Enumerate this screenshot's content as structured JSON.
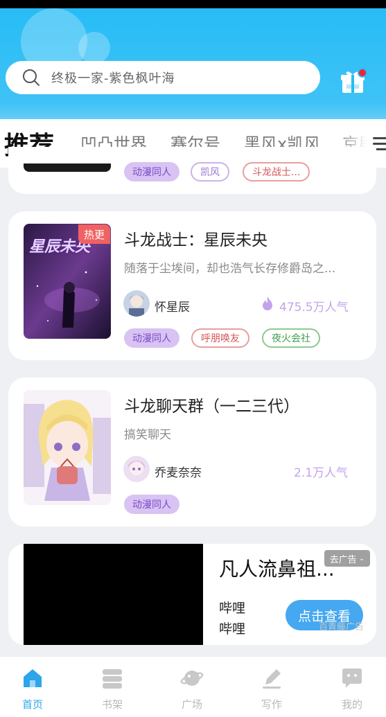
{
  "search": {
    "placeholder": "终极一家-紫色枫叶海"
  },
  "tabs": [
    {
      "label": "推荐",
      "active": true
    },
    {
      "label": "凹凸世界"
    },
    {
      "label": "赛尔号"
    },
    {
      "label": "黑风x凯风"
    },
    {
      "label": "京剧"
    }
  ],
  "cards": [
    {
      "tags": [
        "动漫同人",
        "凯风",
        "斗龙战士..."
      ]
    },
    {
      "title": "斗龙战士：星辰未央",
      "badge": "热更",
      "cover_text": "星辰未央",
      "description": "随落于尘埃间，却也浩气长存修爵岛之...",
      "author": "怀星辰",
      "popularity": "475.5万人气",
      "tags": [
        "动漫同人",
        "呼朋唤友",
        "夜火会社"
      ]
    },
    {
      "title": "斗龙聊天群（一二三代）",
      "description": "搞笑聊天",
      "author": "乔麦奈奈",
      "popularity": "2.1万人气",
      "tags": [
        "动漫同人"
      ]
    }
  ],
  "ad": {
    "title": "凡人流鼻祖...",
    "brand_line1": "哔哩",
    "brand_line2": "哔哩",
    "tag": "去广告",
    "cta": "点击查看",
    "source": "百青藤广告"
  },
  "bottom_nav": [
    {
      "label": "首页",
      "icon": "home-icon",
      "active": true
    },
    {
      "label": "书架",
      "icon": "bookshelf-icon"
    },
    {
      "label": "广场",
      "icon": "planet-icon"
    },
    {
      "label": "写作",
      "icon": "pen-icon"
    },
    {
      "label": "我的",
      "icon": "chat-face-icon"
    }
  ],
  "colors": {
    "accent": "#2ba6ea",
    "header": "#27bcf6",
    "tag_purple": "#d8c3f3",
    "popularity": "#c4a3ee"
  }
}
